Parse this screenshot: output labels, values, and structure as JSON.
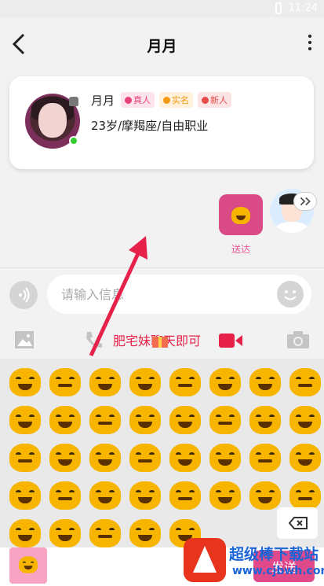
{
  "status_bar": {
    "time": "11:24"
  },
  "header": {
    "title": "月月"
  },
  "profile": {
    "name": "月月",
    "tags": [
      "真人",
      "实名",
      "新人"
    ],
    "info": "23岁/摩羯座/自由职业"
  },
  "message": {
    "status": "送达"
  },
  "input": {
    "placeholder": "请输入信息"
  },
  "annotation": {
    "text": "肥宅妹聊天即可"
  },
  "send_button": {
    "label": "发送"
  },
  "watermark": {
    "name": "超级棒下载站",
    "url": "www.cjbwh.com"
  },
  "colors": {
    "accent": "#e04a8a",
    "arrow": "#e6224b",
    "emoji": "#f7b500"
  }
}
